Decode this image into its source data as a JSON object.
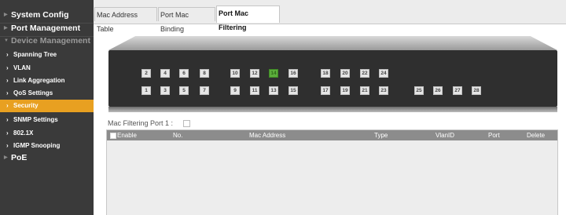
{
  "sidebar": {
    "top_items": [
      {
        "label": "System Config"
      },
      {
        "label": "Port Management"
      },
      {
        "label": "Device Management"
      }
    ],
    "sub_items": [
      {
        "label": "Spanning Tree"
      },
      {
        "label": "VLAN"
      },
      {
        "label": "Link Aggregation"
      },
      {
        "label": "QoS Settings"
      },
      {
        "label": "Security",
        "active": true
      },
      {
        "label": "SNMP Settings"
      },
      {
        "label": "802.1X"
      },
      {
        "label": "IGMP Snooping"
      }
    ],
    "bottom_items": [
      {
        "label": "PoE"
      }
    ]
  },
  "tabs": [
    {
      "label": "Mac Address Table"
    },
    {
      "label": "Port Mac Binding"
    },
    {
      "label": "Port Mac Filtering",
      "active": true
    }
  ],
  "switch_panel": {
    "top_ports": [
      "2",
      "4",
      "6",
      "8",
      "10",
      "12",
      "14",
      "16",
      "18",
      "20",
      "22",
      "24"
    ],
    "bottom_ports": [
      "1",
      "3",
      "5",
      "7",
      "9",
      "11",
      "13",
      "15",
      "17",
      "19",
      "21",
      "23"
    ],
    "uplink_ports": [
      "25",
      "26",
      "27",
      "28"
    ],
    "active_port": "14",
    "colors": {
      "port_up": "#5cae3c",
      "port_idle": "#e6e6e6",
      "panel": "#2f2f2f"
    }
  },
  "filter": {
    "label": "Mac Filtering Port 1 :"
  },
  "table": {
    "headers": {
      "enable": "Enable",
      "no": "No.",
      "mac": "Mac Address",
      "type": "Type",
      "vlan": "VlanID",
      "port": "Port",
      "delete": "Delete"
    },
    "rows": []
  },
  "colors": {
    "sidebar_bg": "#3a3a3a",
    "active_item": "#e8a021",
    "table_header": "#8c8c8c"
  }
}
